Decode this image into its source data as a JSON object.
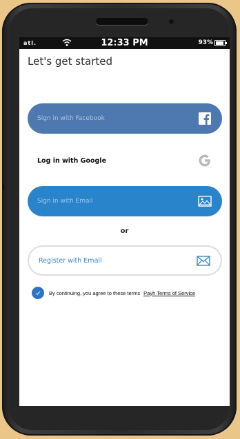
{
  "status_bar": {
    "signal": "atl.",
    "time": "12:33 PM",
    "battery_pct": "93%"
  },
  "page": {
    "title": "Let's get started"
  },
  "buttons": {
    "facebook_label": "Sign in with Facebook",
    "facebook_icon": "facebook-icon",
    "google_label": "Log in with Google",
    "google_icon": "google-icon",
    "email_login_label": "Sign in with Email",
    "email_login_icon": "image-icon",
    "or_text": "or",
    "register_label": "Register with Email",
    "register_icon": "envelope-icon"
  },
  "terms": {
    "text": "By continuing, you agree to these terms",
    "link_label": "Payh Terms of Service"
  },
  "colors": {
    "facebook_blue": "#4e79b0",
    "email_blue": "#2a84cb",
    "register_text": "#3a87c8",
    "terms_check": "#2f74c4",
    "background": "#eac688"
  }
}
